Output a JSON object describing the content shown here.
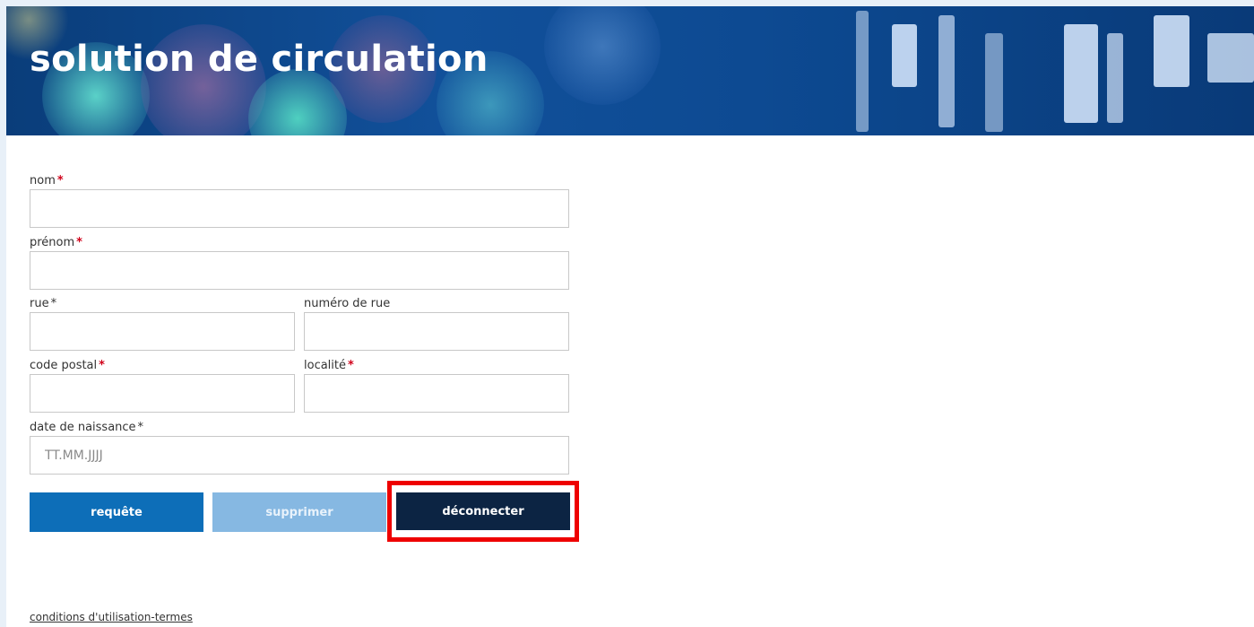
{
  "header": {
    "title": "solution de circulation"
  },
  "form": {
    "nom": {
      "label": "nom",
      "required": "*",
      "value": ""
    },
    "prenom": {
      "label": "prénom",
      "required": "*",
      "value": ""
    },
    "rue": {
      "label": "rue",
      "required": "*",
      "value": ""
    },
    "numero_rue": {
      "label": "numéro de rue",
      "value": ""
    },
    "code_postal": {
      "label": "code postal",
      "required": "*",
      "value": ""
    },
    "localite": {
      "label": "localité",
      "required": "*",
      "value": ""
    },
    "date_naissance": {
      "label": "date de naissance",
      "required": "*",
      "placeholder": "TT.MM.JJJJ",
      "value": ""
    }
  },
  "buttons": {
    "requete": "requête",
    "supprimer": "supprimer",
    "deconnecter": "déconnecter"
  },
  "footer": {
    "terms_link": "conditions d'utilisation-termes"
  },
  "colors": {
    "primary": "#0d6eb8",
    "disabled": "#86b8e2",
    "dark": "#0c2443",
    "required": "#d0021b",
    "highlight": "#ee0000"
  }
}
